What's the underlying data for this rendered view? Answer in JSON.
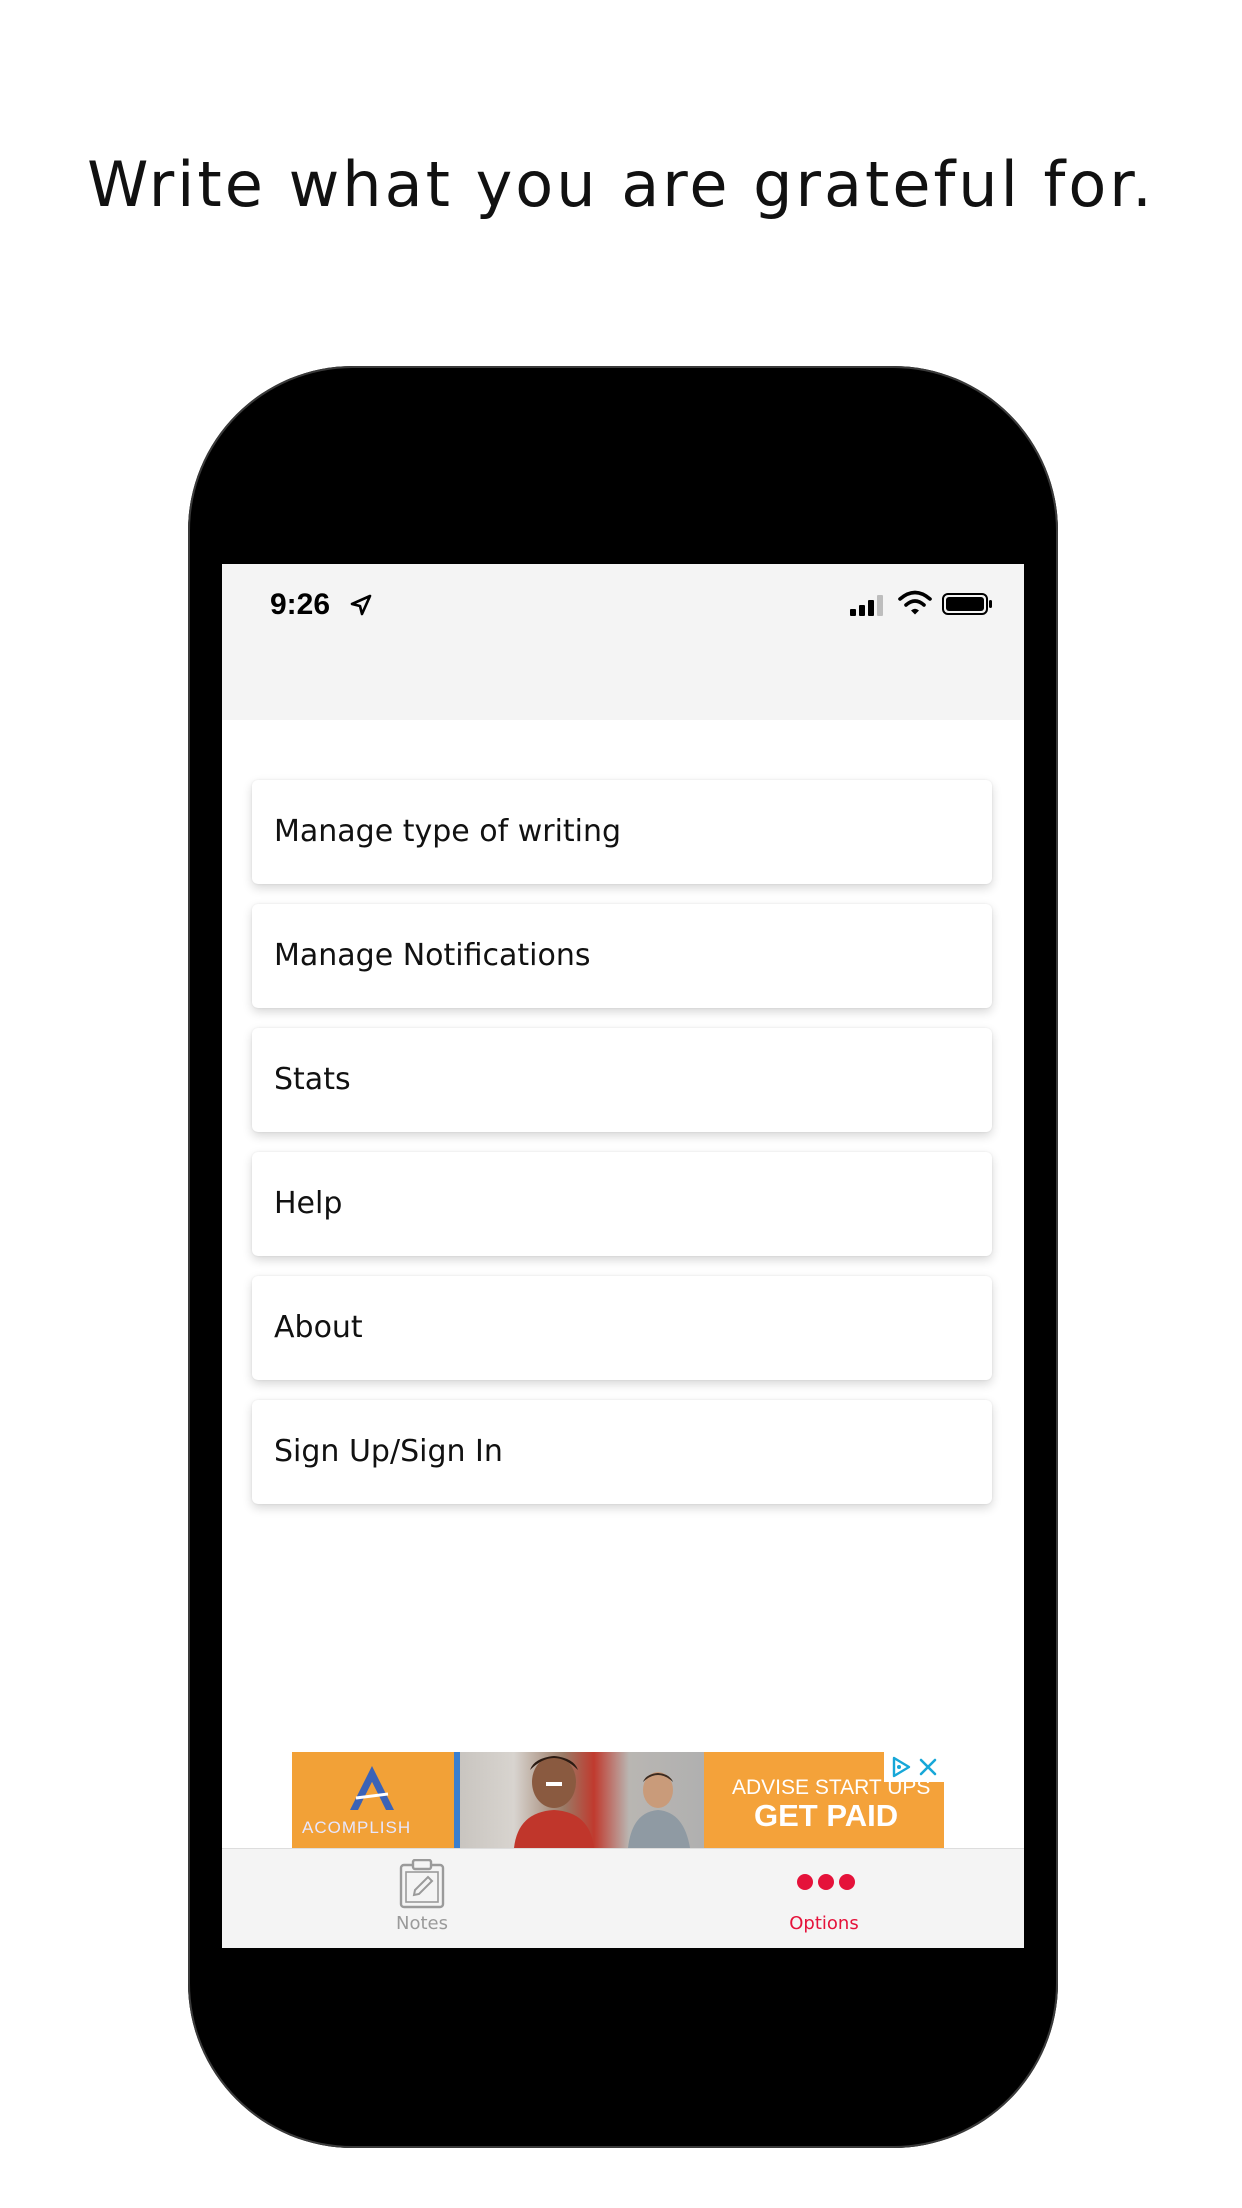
{
  "headline": "Write what you are grateful for.",
  "status_bar": {
    "time": "9:26",
    "icons": [
      "location-arrow-icon",
      "cellular-signal-icon",
      "wifi-icon",
      "battery-icon"
    ]
  },
  "menu": {
    "items": [
      {
        "label": "Manage type of writing"
      },
      {
        "label": "Manage Notifications"
      },
      {
        "label": "Stats"
      },
      {
        "label": "Help"
      },
      {
        "label": "About"
      },
      {
        "label": "Sign Up/Sign In"
      }
    ]
  },
  "ad": {
    "brand": "ACOMPLISH",
    "line1": "ADVISE START UPS",
    "line2": "GET PAID"
  },
  "tabs": {
    "notes": {
      "label": "Notes",
      "icon": "clipboard-edit-icon"
    },
    "options": {
      "label": "Options",
      "icon": "dots-icon"
    }
  },
  "colors": {
    "accent": "#e5123a",
    "inactive_tab": "#9a9a9a",
    "header_bg": "#f4f4f4",
    "ad_orange": "#f4a23a"
  }
}
